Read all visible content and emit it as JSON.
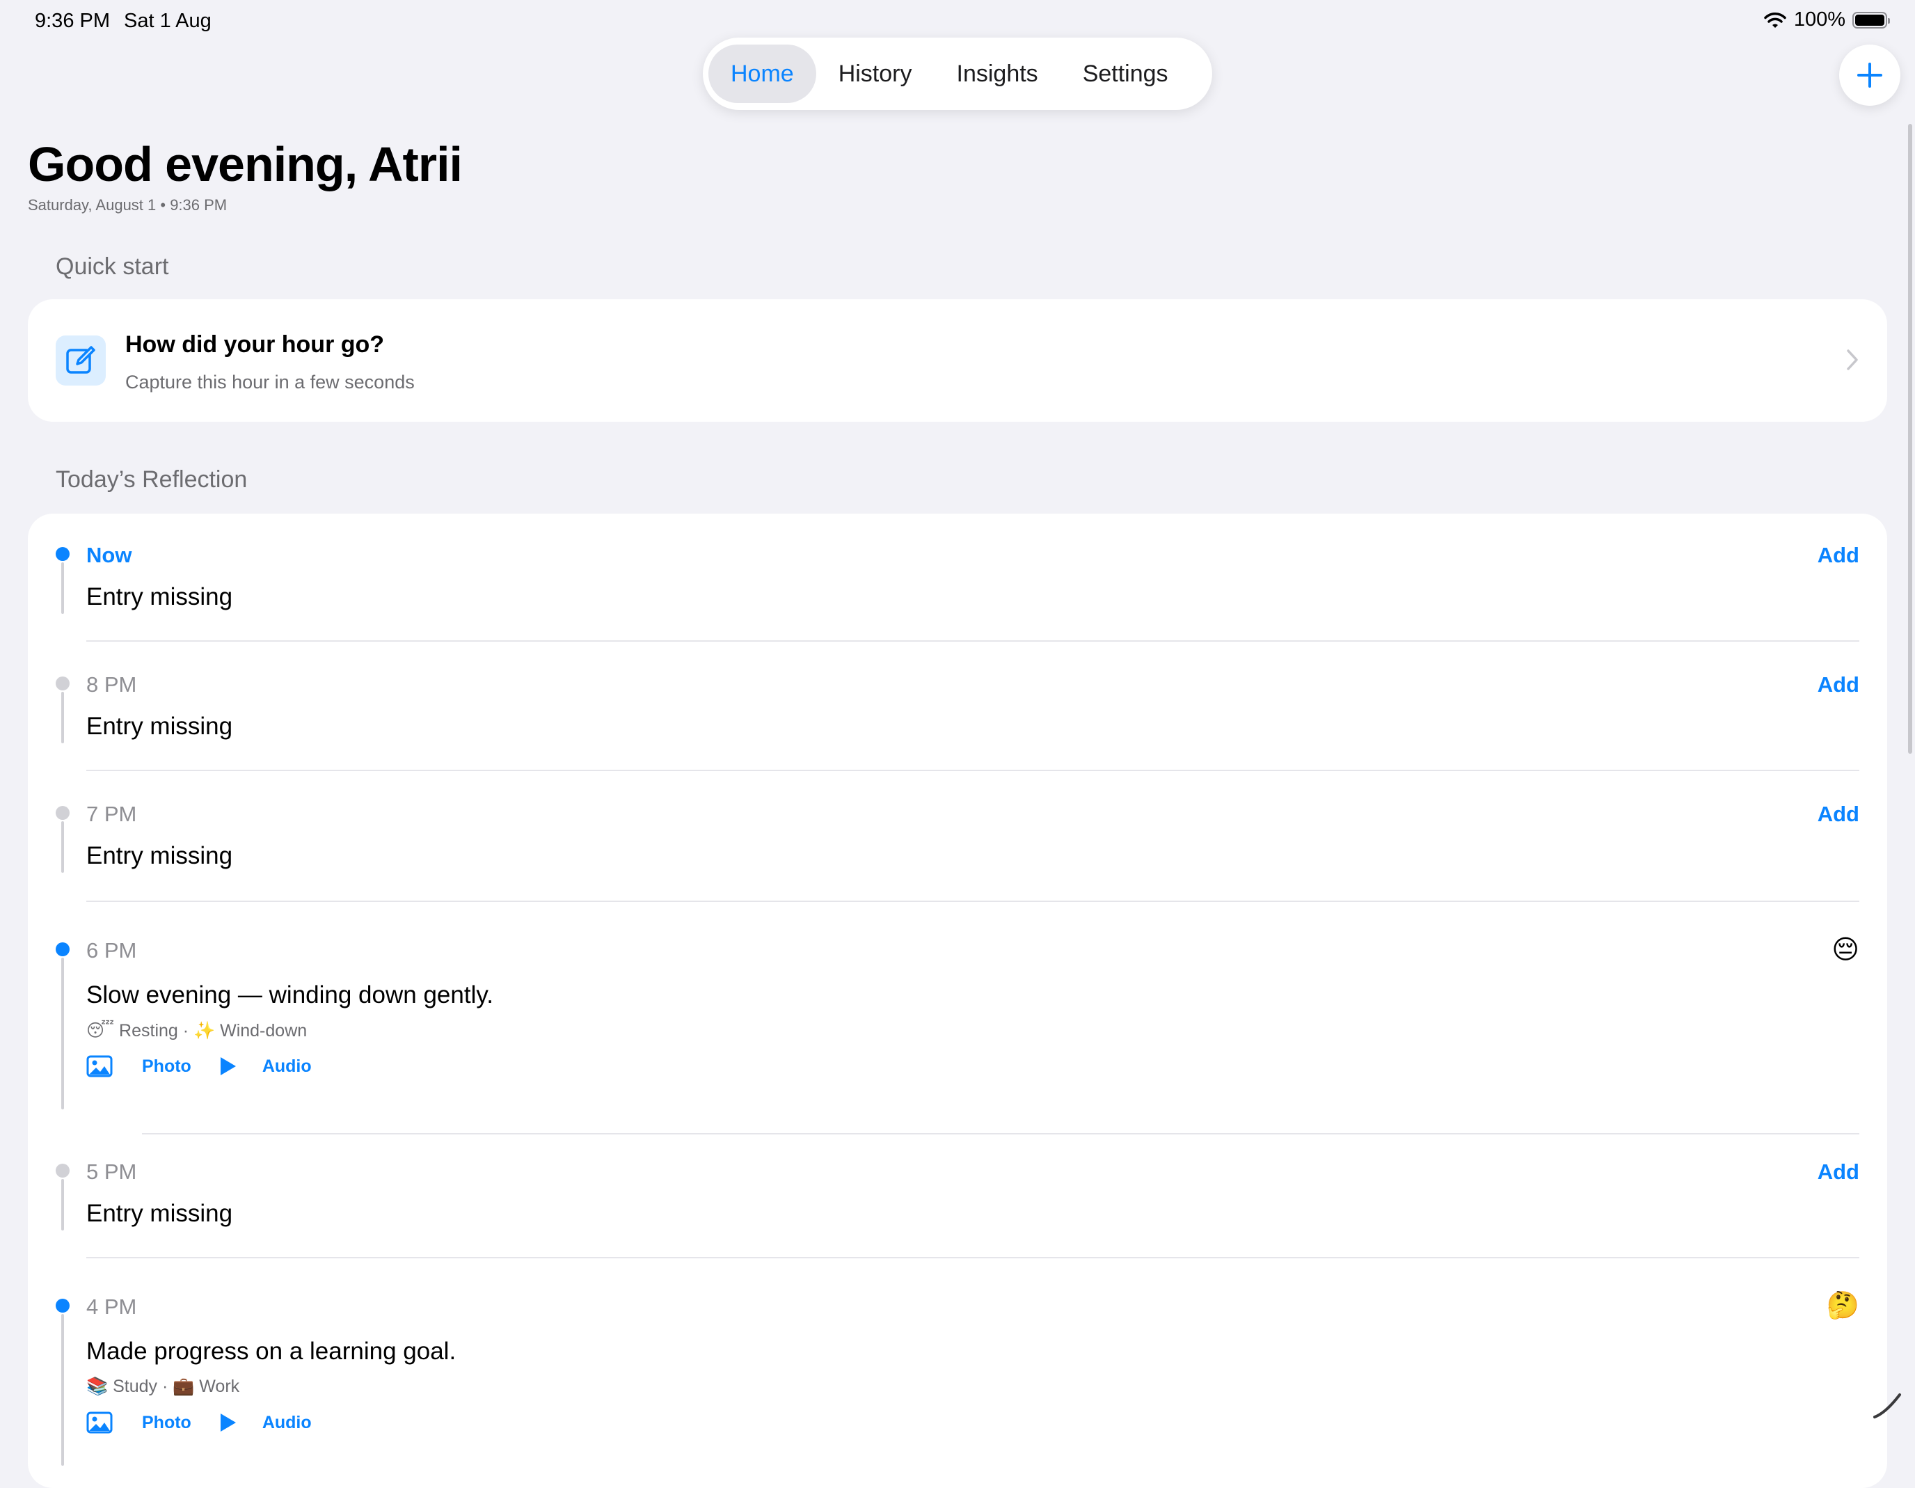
{
  "status_bar": {
    "time": "9:36 PM",
    "date": "Sat 1 Aug",
    "battery": "100%"
  },
  "tabs": [
    {
      "label": "Home",
      "active": true
    },
    {
      "label": "History",
      "active": false
    },
    {
      "label": "Insights",
      "active": false
    },
    {
      "label": "Settings",
      "active": false
    }
  ],
  "header": {
    "greeting": "Good evening, Atrii",
    "subtitle": "Saturday, August 1 • 9:36 PM"
  },
  "quick_start": {
    "heading": "Quick start",
    "title": "How did your hour go?",
    "subtitle": "Capture this hour in a few seconds"
  },
  "reflection": {
    "heading": "Today’s Reflection",
    "entries": [
      {
        "hour": "Now",
        "text": "Entry missing",
        "action": "Add"
      },
      {
        "hour": "8 PM",
        "text": "Entry missing",
        "action": "Add"
      },
      {
        "hour": "7 PM",
        "text": "Entry missing",
        "action": "Add"
      },
      {
        "hour": "6 PM",
        "text": "Slow evening — winding down gently.",
        "mood": "😔",
        "tags": "😴 Resting · ✨ Wind-down",
        "photo": "Photo",
        "audio": "Audio"
      },
      {
        "hour": "5 PM",
        "text": "Entry missing",
        "action": "Add"
      },
      {
        "hour": "4 PM",
        "text": "Made progress on a learning goal.",
        "mood": "🤔",
        "tags": "📚 Study · 💼 Work",
        "photo": "Photo",
        "audio": "Audio"
      }
    ]
  },
  "colors": {
    "accent": "#0a84ff",
    "background": "#f2f2f7",
    "card": "#ffffff",
    "secondary_text": "#6c6c70"
  }
}
